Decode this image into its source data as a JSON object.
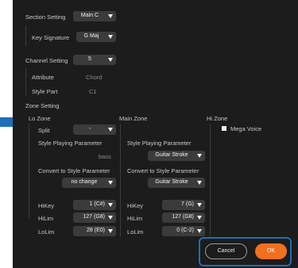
{
  "section_setting": {
    "label": "Section Setting",
    "value": "Main C"
  },
  "key_signature": {
    "label": "Key Signature",
    "value": "G Maj"
  },
  "channel_setting": {
    "label": "Channel Setting",
    "value": "5"
  },
  "attribute": {
    "label": "Attribute",
    "value": "Chord"
  },
  "style_part": {
    "label": "Style Part",
    "value": "C1"
  },
  "zone_setting": {
    "label": "Zone Setting"
  },
  "lo_zone": {
    "title": "Lo Zone",
    "split_label": "Split",
    "split_value": "-",
    "spp_label": "Style Playing Parameter",
    "spp_value": "bass",
    "cts_label": "Convert to Style Parameter",
    "cts_value": "no change",
    "hikey_label": "HiKey",
    "hikey_value": "1 (C#)",
    "hilim_label": "HiLim",
    "hilim_value": "127 (G8)",
    "lolim_label": "LoLim",
    "lolim_value": "28 (E0)"
  },
  "main_zone": {
    "title": "Main Zone",
    "spp_label": "Style Playing Parameter",
    "spp_value": "Guitar Stroke",
    "cts_label": "Convert to Style Parameter",
    "cts_value": "Guitar Stroke",
    "hikey_label": "HiKey",
    "hikey_value": "7 (G)",
    "hilim_label": "HiLim",
    "hilim_value": "127 (G8)",
    "lolim_label": "LoLim",
    "lolim_value": "0 (C-2)"
  },
  "hi_zone": {
    "title": "Hi Zone",
    "mega_voice_label": "Mega Voice"
  },
  "buttons": {
    "cancel": "Cancel",
    "ok": "OK"
  },
  "colors": {
    "accent": "#f07020",
    "highlight": "#1f6fb8",
    "arrow": "#1f6fb8",
    "panel": "#1c1c1c"
  }
}
